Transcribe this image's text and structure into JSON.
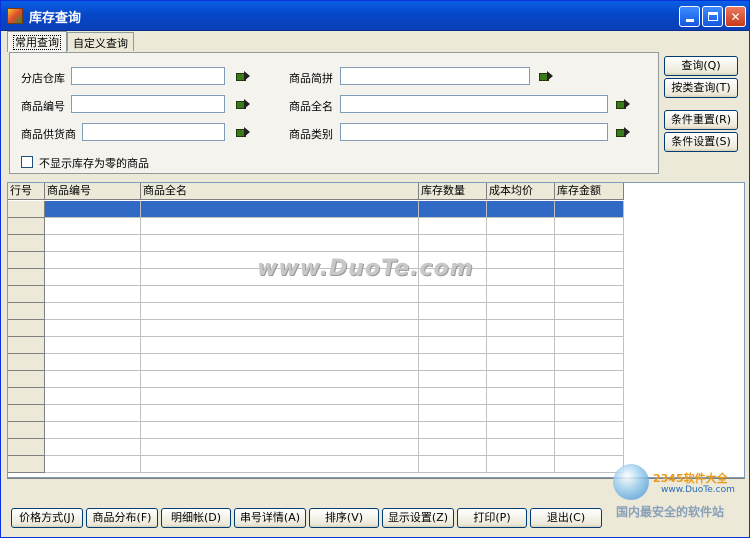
{
  "window": {
    "title": "库存查询"
  },
  "tabs": [
    {
      "label": "常用查询"
    },
    {
      "label": "自定义查询"
    }
  ],
  "form": {
    "branch_warehouse": {
      "label": "分店仓库",
      "value": ""
    },
    "product_code": {
      "label": "商品编号",
      "value": ""
    },
    "supplier": {
      "label": "商品供货商",
      "value": ""
    },
    "short_name": {
      "label": "商品简拼",
      "value": ""
    },
    "full_name": {
      "label": "商品全名",
      "value": ""
    },
    "category": {
      "label": "商品类别",
      "value": ""
    },
    "hide_zero_stock": {
      "label": "不显示库存为零的商品",
      "checked": false
    }
  },
  "side_buttons": [
    {
      "label": "查询(Q)"
    },
    {
      "label": "按类查询(T)"
    },
    {
      "label": "条件重置(R)"
    },
    {
      "label": "条件设置(S)"
    }
  ],
  "grid": {
    "columns": [
      "行号",
      "商品编号",
      "商品全名",
      "库存数量",
      "成本均价",
      "库存金额"
    ],
    "visible_rows": 16,
    "selected_row": 1
  },
  "watermark": "www.DuoTe.com",
  "bottom_buttons": [
    {
      "label": "价格方式(J)"
    },
    {
      "label": "商品分布(F)"
    },
    {
      "label": "明细帐(D)"
    },
    {
      "label": "串号详情(A)"
    },
    {
      "label": "排序(V)"
    },
    {
      "label": "显示设置(Z)"
    },
    {
      "label": "打印(P)"
    },
    {
      "label": "退出(C)"
    }
  ],
  "brand": {
    "name": "2345软件大全",
    "url": "www.DuoTe.com",
    "slogan": "国内最安全的软件站"
  }
}
